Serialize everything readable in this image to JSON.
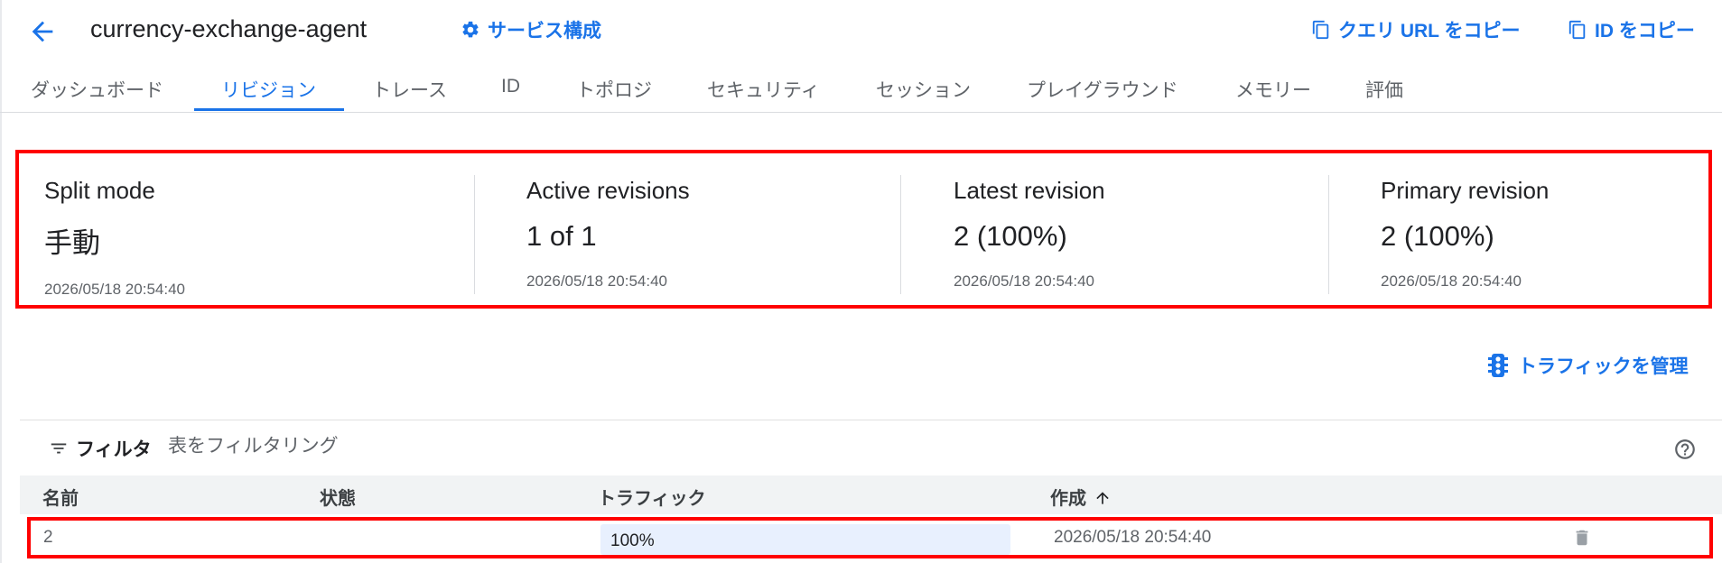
{
  "header": {
    "title": "currency-exchange-agent",
    "service_config": "サービス構成",
    "copy_query_url": "クエリ URL をコピー",
    "copy_id": "ID をコピー"
  },
  "tabs": [
    {
      "label": "ダッシュボード",
      "active": false
    },
    {
      "label": "リビジョン",
      "active": true
    },
    {
      "label": "トレース",
      "active": false
    },
    {
      "label": "ID",
      "active": false
    },
    {
      "label": "トポロジ",
      "active": false
    },
    {
      "label": "セキュリティ",
      "active": false
    },
    {
      "label": "セッション",
      "active": false
    },
    {
      "label": "プレイグラウンド",
      "active": false
    },
    {
      "label": "メモリー",
      "active": false
    },
    {
      "label": "評価",
      "active": false
    }
  ],
  "summary": [
    {
      "label": "Split mode",
      "value": "手動",
      "time": "2026/05/18 20:54:40"
    },
    {
      "label": "Active revisions",
      "value": "1 of 1",
      "time": "2026/05/18 20:54:40"
    },
    {
      "label": "Latest revision",
      "value": "2 (100%)",
      "time": "2026/05/18 20:54:40"
    },
    {
      "label": "Primary revision",
      "value": "2 (100%)",
      "time": "2026/05/18 20:54:40"
    }
  ],
  "manage_traffic": "トラフィックを管理",
  "filter": {
    "label": "フィルタ",
    "placeholder": "表をフィルタリング"
  },
  "table": {
    "columns": [
      "名前",
      "状態",
      "トラフィック",
      "作成"
    ],
    "sort_column": "作成",
    "sort_direction": "ascending",
    "rows": [
      {
        "name": "2",
        "status": "",
        "traffic": "100%",
        "traffic_fraction": 1.0,
        "created": "2026/05/18 20:54:40"
      }
    ]
  },
  "colors": {
    "accent": "#1a73e8",
    "highlight": "#ff0000",
    "traffic_fill": "#e8f0fe"
  },
  "icons": {
    "back": "arrow-left-icon",
    "service": "gear-icon",
    "copy": "copy-icon",
    "traffic": "traffic-light-icon",
    "filter": "filter-icon",
    "help": "help-icon",
    "sort": "arrow-up-icon",
    "delete": "trash-icon"
  }
}
